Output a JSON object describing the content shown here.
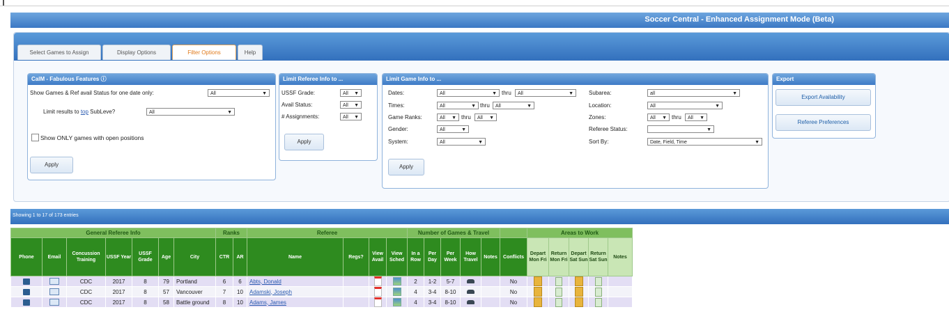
{
  "app_title": "Soccer Central - Enhanced Assignment Mode (Beta)",
  "tabs": [
    "Select Games to Assign",
    "Display Options",
    "Filter Options",
    "Help"
  ],
  "custom_features": {
    "header": "CalM - Fabulous Features",
    "show_games_label": "Show Games & Ref avail Status for one date only:",
    "show_games_value": "All",
    "limit_label_prefix": "Limit results to",
    "limit_label_link": "top",
    "limit_label_suffix": "SubLeve?",
    "limit_value": "All",
    "open_positions_label": "Show ONLY games with open positions",
    "apply_label": "Apply"
  },
  "limit_referee": {
    "header": "Limit Referee Info to ...",
    "rows": [
      {
        "label": "USSF Grade:",
        "value": "All"
      },
      {
        "label": "Avail Status:",
        "value": "All"
      },
      {
        "label": "# Assignments:",
        "value": "All"
      }
    ],
    "apply_label": "Apply"
  },
  "limit_game": {
    "header": "Limit Game Info to ...",
    "dates_label": "Dates:",
    "dates_value": "All",
    "dates_thru_label": "thru",
    "dates_thru_value": "All",
    "times_label": "Times:",
    "times_value": "All",
    "times_thru_label": "thru",
    "times_thru_value": "All",
    "rank_label": "Game Ranks:",
    "rank_value": "All",
    "rank_thru_label": "thru",
    "rank_thru_value": "All",
    "gender_label": "Gender:",
    "gender_value": "All",
    "system_label": "System:",
    "system_value": "All",
    "subarea_label": "Subarea:",
    "subarea_value": "all",
    "location_label": "Location:",
    "location_value": "All",
    "zones_label": "Zones:",
    "zones_value": "All",
    "zones_thru_label": "thru",
    "zones_thru_value": "All",
    "referee_status_label": "Referee Status:",
    "referee_status_value": "",
    "sort_label": "Sort By:",
    "sort_value": "Date, Field, Time",
    "apply_label": "Apply"
  },
  "export": {
    "header": "Export",
    "availability_label": "Export Availability",
    "preferences_label": "Referee Preferences"
  },
  "results": {
    "showing_text": "Showing 1 to 17 of 173 entries"
  },
  "group_headers": {
    "general": "General Referee Info",
    "ranks": "Ranks",
    "referee": "Referee",
    "games_travel": "Number of Games & Travel",
    "areas": "Areas to Work"
  },
  "columns": [
    "Phone",
    "Email",
    "Concussion Training",
    "USSF Year",
    "USSF Grade",
    "Age",
    "City",
    "CTR",
    "AR",
    "Name",
    "Regs?",
    "View Avail",
    "View Sched",
    "In a Row",
    "Per Day",
    "Per Week",
    "How Travel",
    "Notes",
    "Conflicts",
    "Depart Mon Fri",
    "Return Mon Fri",
    "Depart Sat Sun",
    "Return Sat Sun",
    "Notes"
  ],
  "rows": [
    {
      "training": "CDC",
      "year": "2017",
      "grade": "8",
      "age": "79",
      "city": "Portland",
      "ctr": "6",
      "ar": "6",
      "name": "Abts, Donald",
      "in_row": "2",
      "per_day": "1-2",
      "per_week": "5-7",
      "conflicts": "No"
    },
    {
      "training": "CDC",
      "year": "2017",
      "grade": "8",
      "age": "57",
      "city": "Vancouver",
      "ctr": "7",
      "ar": "10",
      "name": "Adamski, Joseph",
      "in_row": "4",
      "per_day": "3-4",
      "per_week": "8-10",
      "conflicts": "No"
    },
    {
      "training": "CDC",
      "year": "2017",
      "grade": "8",
      "age": "58",
      "city": "Battle ground",
      "ctr": "8",
      "ar": "10",
      "name": "Adams, James",
      "in_row": "4",
      "per_day": "3-4",
      "per_week": "8-10",
      "conflicts": "No"
    }
  ],
  "icons": {
    "phone": "phone-icon",
    "email": "email-icon",
    "avail": "calendar-icon",
    "sched": "schedule-icon",
    "travel": "car-icon",
    "area_depart": "document-icon",
    "area_return": "page-icon"
  },
  "colors": {
    "header_blue": "#3b78c4",
    "group_green": "#7fbf5e",
    "column_green": "#2e8b1f",
    "row_lavender": "#e3def4",
    "active_tab": "#e07a1b"
  }
}
